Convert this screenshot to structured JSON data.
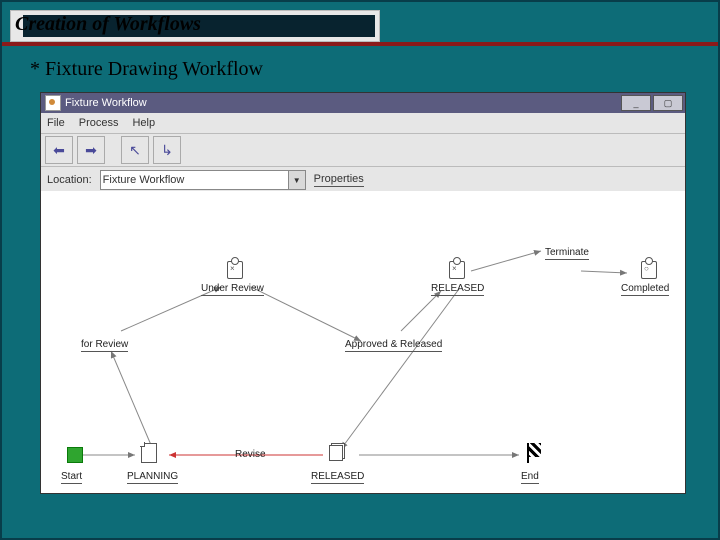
{
  "slide": {
    "title": "Creation of Workflows",
    "subtitle": "* Fixture Drawing Workflow"
  },
  "window": {
    "title": "Fixture Workflow",
    "menu": {
      "file": "File",
      "process": "Process",
      "help": "Help"
    },
    "toolbar": {
      "back": "⬅",
      "fwd": "➡",
      "up": "↖",
      "down": "↳"
    },
    "location_label": "Location:",
    "location_value": "Fixture Workflow",
    "properties_link": "Properties"
  },
  "nodes": {
    "start": "Start",
    "planning": "PLANNING",
    "for_review": "for Review",
    "under_review": "Under Review",
    "approved_released": "Approved & Released",
    "released_top": "RELEASED",
    "released_bottom": "RELEASED",
    "terminate": "Terminate",
    "completed": "Completed",
    "revise": "Revise",
    "end": "End"
  }
}
